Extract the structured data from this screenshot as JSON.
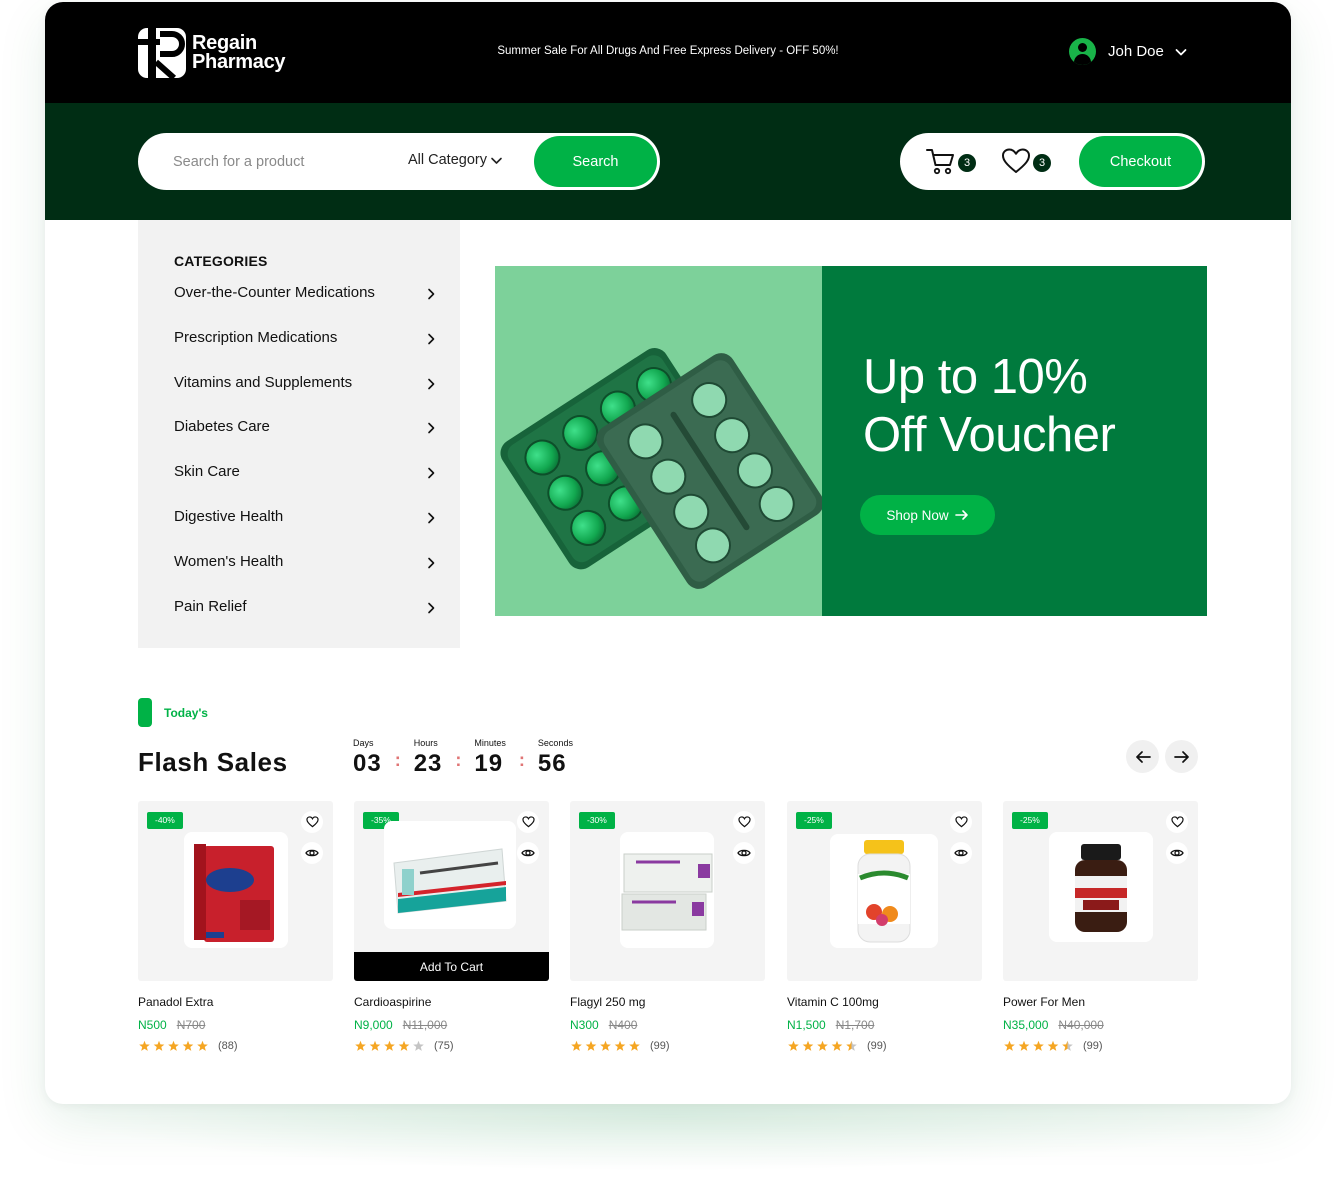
{
  "brand": {
    "line1": "Regain",
    "line2": "Pharmacy"
  },
  "announcement": "Summer Sale For All Drugs And Free Express Delivery - OFF 50%!",
  "user": {
    "name": "Joh Doe"
  },
  "search": {
    "placeholder": "Search for a product",
    "category": "All Category",
    "button": "Search"
  },
  "actions": {
    "cart_count": "3",
    "wishlist_count": "3",
    "checkout": "Checkout"
  },
  "categories": {
    "title": "CATEGORIES",
    "items": [
      {
        "label": "Over-the-Counter Medications"
      },
      {
        "label": "Prescription Medications"
      },
      {
        "label": "Vitamins and Supplements"
      },
      {
        "label": "Diabetes Care"
      },
      {
        "label": "Skin Care"
      },
      {
        "label": "Digestive Health"
      },
      {
        "label": "Women's Health"
      },
      {
        "label": "Pain Relief"
      }
    ]
  },
  "banner": {
    "line1": "Up to 10%",
    "line2": "Off Voucher",
    "button": "Shop Now"
  },
  "flash": {
    "tag": "Today's",
    "title": "Flash Sales",
    "countdown": [
      {
        "label": "Days",
        "value": "03"
      },
      {
        "label": "Hours",
        "value": "23"
      },
      {
        "label": "Minutes",
        "value": "19"
      },
      {
        "label": "Seconds",
        "value": "56"
      }
    ],
    "add_to_cart": "Add To Cart",
    "products": [
      {
        "name": "Panadol Extra",
        "discount": "-40%",
        "price": "N500",
        "old_price": "N700",
        "rating": 5,
        "reviews": "(88)",
        "image_color": "#c8202c"
      },
      {
        "name": "Cardioaspirine",
        "discount": "-35%",
        "price": "N9,000",
        "old_price": "N11,000",
        "rating": 4,
        "reviews": "(75)",
        "image_color": "#16a39a"
      },
      {
        "name": "Flagyl 250 mg",
        "discount": "-30%",
        "price": "N300",
        "old_price": "N400",
        "rating": 5,
        "reviews": "(99)",
        "image_color": "#e7ece7"
      },
      {
        "name": "Vitamin C 100mg",
        "discount": "-25%",
        "price": "N1,500",
        "old_price": "N1,700",
        "rating": 4.5,
        "reviews": "(99)",
        "image_color": "#f5c21a"
      },
      {
        "name": "Power For  Men",
        "discount": "-25%",
        "price": "N35,000",
        "old_price": "N40,000",
        "rating": 4.5,
        "reviews": "(99)",
        "image_color": "#3a1d12"
      }
    ]
  },
  "colors": {
    "primary": "#00b246",
    "dark_green": "#002d14",
    "banner_green": "#007a3d",
    "banner_light": "#7dd19a",
    "star": "#f5a623"
  }
}
